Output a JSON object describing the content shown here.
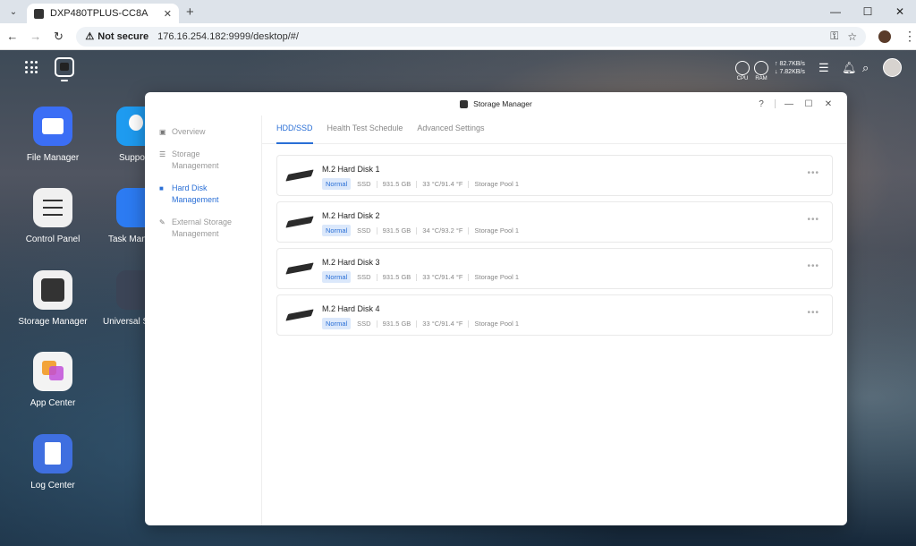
{
  "browser": {
    "tab_title": "DXP480TPLUS-CC8A",
    "security_label": "Not secure",
    "url": "176.16.254.182:9999/desktop/#/"
  },
  "topbar": {
    "cpu_label": "CPU",
    "ram_label": "RAM",
    "upload": "↑ 82.7KB/s",
    "download": "↓ 7.82KB/s"
  },
  "desktop": {
    "icons": [
      {
        "label": "File Manager",
        "color": "#3b6ef5"
      },
      {
        "label": "Control Panel",
        "color": "#f0f0f0"
      },
      {
        "label": "Storage Manager",
        "color": "#f0f0f0"
      },
      {
        "label": "App Center",
        "color": "#f3f3f3"
      },
      {
        "label": "Log Center",
        "color": "#3f6fe0"
      },
      {
        "label": "Suppo",
        "color": "#1e9bf0"
      },
      {
        "label": "Task Mana",
        "color": "#2c7bf2"
      },
      {
        "label": "Universal S",
        "color": "#3b4456"
      }
    ]
  },
  "window": {
    "title": "Storage Manager",
    "sidebar": [
      {
        "label": "Overview",
        "icon": "overview-icon"
      },
      {
        "label": "Storage Management",
        "icon": "storage-icon"
      },
      {
        "label": "Hard Disk Management",
        "icon": "hard-disk-icon",
        "active": true
      },
      {
        "label": "External Storage Management",
        "icon": "external-storage-icon"
      }
    ],
    "tabs": [
      "HDD/SSD",
      "Health Test Schedule",
      "Advanced Settings"
    ],
    "disks": [
      {
        "name": "M.2 Hard Disk 1",
        "status": "Normal",
        "type": "SSD",
        "size": "931.5 GB",
        "temp": "33 °C/91.4 °F",
        "pool": "Storage Pool 1"
      },
      {
        "name": "M.2 Hard Disk 2",
        "status": "Normal",
        "type": "SSD",
        "size": "931.5 GB",
        "temp": "34 °C/93.2 °F",
        "pool": "Storage Pool 1"
      },
      {
        "name": "M.2 Hard Disk 3",
        "status": "Normal",
        "type": "SSD",
        "size": "931.5 GB",
        "temp": "33 °C/91.4 °F",
        "pool": "Storage Pool 1"
      },
      {
        "name": "M.2 Hard Disk 4",
        "status": "Normal",
        "type": "SSD",
        "size": "931.5 GB",
        "temp": "33 °C/91.4 °F",
        "pool": "Storage Pool 1"
      }
    ]
  }
}
